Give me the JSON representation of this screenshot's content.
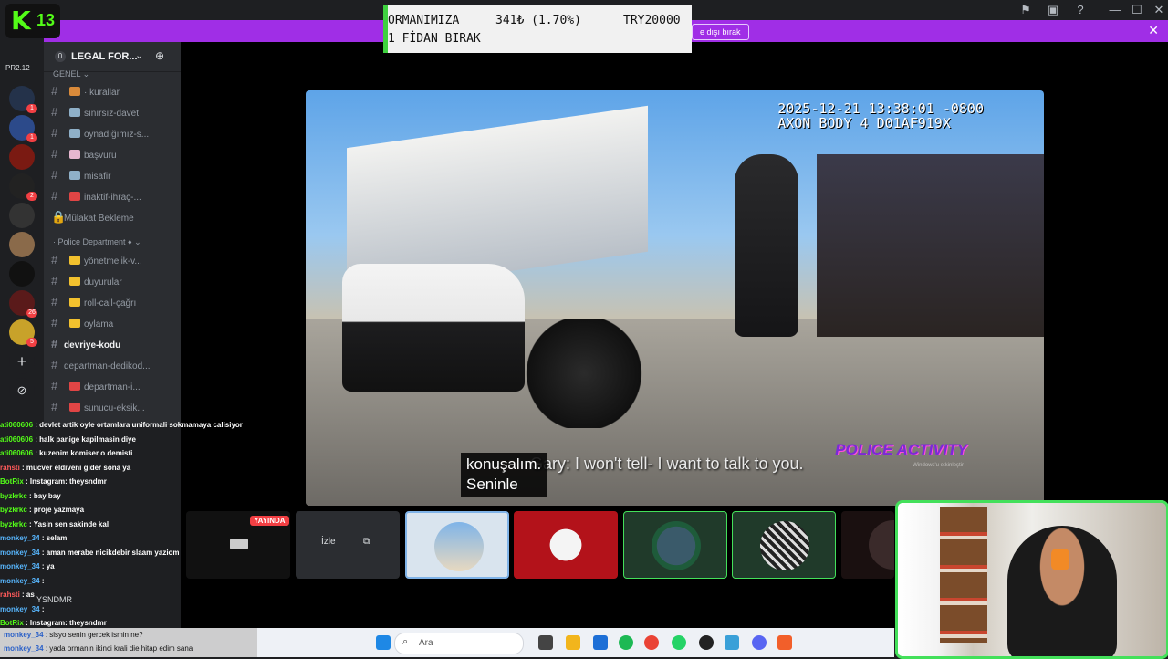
{
  "sponsor": {
    "line1_a": "ORMANIMIZA",
    "line1_b": "341₺ (1.70%)",
    "line1_c": "TRY20000",
    "line2": "1 FİDAN BIRAK"
  },
  "kick": {
    "logo": "K",
    "number": "13"
  },
  "banner": {
    "button_label": "e dışı bırak",
    "close": "✕"
  },
  "window_controls": {
    "min": "—",
    "max": "☐",
    "close": "✕"
  },
  "guilds": [
    {
      "label": "PR2.12"
    },
    {
      "badge": "1"
    },
    {
      "badge": "1"
    },
    {
      "badge": ""
    },
    {
      "badge": "2"
    },
    {
      "badge": ""
    },
    {
      "badge": ""
    },
    {
      "badge": ""
    },
    {
      "badge": "26"
    },
    {
      "badge": "5"
    }
  ],
  "guild_actions": {
    "add": "+",
    "explore": "⊘"
  },
  "server": {
    "pill": "0",
    "name": "LEGAL FOR...",
    "chevron": "⌄",
    "add_member": "⊕"
  },
  "channels": {
    "category_1": "GENEL ⌄",
    "items_1": [
      "· kurallar",
      "sınırsız-davet",
      "oynadığımız-s...",
      "başvuru",
      "misafir",
      "inaktif-ihraç-...",
      "Mülakat Bekleme"
    ],
    "category_2": "· Police Department ♦ ⌄",
    "items_2": [
      "yönetmelik-v...",
      "duyurular",
      "roll-call-çağrı",
      "oylama",
      "devriye-kodu",
      "departman-dedikod...",
      "departman-i...",
      "sunucu-eksik..."
    ]
  },
  "video": {
    "stamp_line1": "2025-12-21 13:38:01 -0800",
    "stamp_line2": "AXON BODY 4 D01AF919X",
    "caption_en": "Gary: I won't tell- I want to talk to you.",
    "caption_tr_1": "konuşalım.",
    "caption_tr_2": "Seninle",
    "logo": "POLICE ACTIVITY",
    "watermark": "Windows'u etkinleştir"
  },
  "tiles": {
    "live": "YAYINDA",
    "watch": "İzle"
  },
  "chat": [
    {
      "user": "ati060606",
      "text": "devlet artik oyle ortamlara uniformali sokmamaya calisiyor",
      "color": "#53fc18"
    },
    {
      "user": "ati060606",
      "text": "halk panige kapilmasin diye",
      "color": "#53fc18"
    },
    {
      "user": "ati060606",
      "text": "kuzenim komiser o demisti",
      "color": "#53fc18"
    },
    {
      "user": "rahsti",
      "text": "mücver eldiveni gider sona ya",
      "color": "#ff5a5a"
    },
    {
      "user": "BotRix",
      "text": "Instagram: theysndmr",
      "color": "#53fc18"
    },
    {
      "user": "byzkrkc",
      "text": "bay bay",
      "color": "#53fc18"
    },
    {
      "user": "byzkrkc",
      "text": "proje yazmaya",
      "color": "#53fc18"
    },
    {
      "user": "byzkrkc",
      "text": "Yasin sen sakinde kal",
      "color": "#53fc18"
    },
    {
      "user": "monkey_34",
      "text": "selam",
      "color": "#58b7ff"
    },
    {
      "user": "monkey_34",
      "text": "aman merabe nicikdebir slaam yaziom",
      "color": "#58b7ff"
    },
    {
      "user": "monkey_34",
      "text": "ya",
      "color": "#58b7ff"
    },
    {
      "user": "monkey_34",
      "text": "",
      "color": "#58b7ff"
    },
    {
      "user": "rahsti",
      "text": "as",
      "color": "#ff5a5a"
    },
    {
      "user": "monkey_34",
      "text": "",
      "color": "#58b7ff"
    },
    {
      "user": "BotRix",
      "text": "Instagram: theysndmr",
      "color": "#53fc18"
    }
  ],
  "chat_bottom": [
    {
      "user": "monkey_34",
      "text": "slsyo senin gercek ismin ne?"
    },
    {
      "user": "monkey_34",
      "text": "yada ormanin ikinci krali die hitap edim sana"
    }
  ],
  "user_panel": {
    "name": "YSNDMR"
  },
  "taskbar": {
    "search_placeholder": "Ara"
  },
  "colors": {
    "accent": "#a02ee6",
    "kick_green": "#53fc18",
    "live_red": "#f23f43",
    "cam_border": "#43e05a"
  }
}
